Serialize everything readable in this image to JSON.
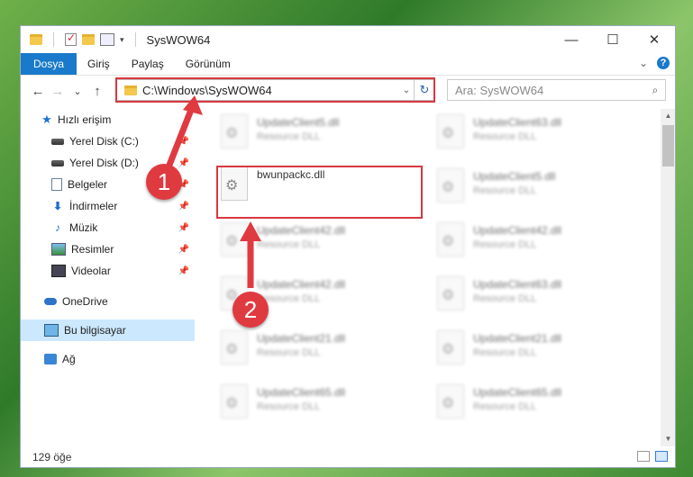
{
  "window": {
    "title": "SysWOW64",
    "minimize": "—",
    "maximize": "☐",
    "close": "✕"
  },
  "ribbon": {
    "tabs": [
      "Dosya",
      "Giriş",
      "Paylaş",
      "Görünüm"
    ],
    "expand": "⌄",
    "help": "?"
  },
  "nav": {
    "back": "←",
    "forward": "→",
    "recent": "⌄",
    "up": "↑"
  },
  "address": {
    "path": "C:\\Windows\\SysWOW64",
    "dropdown": "⌄",
    "refresh": "↻"
  },
  "search": {
    "placeholder": "Ara: SysWOW64",
    "icon": "⌕"
  },
  "sidebar": {
    "quick_access": "Hızlı erişim",
    "items": [
      {
        "label": "Yerel Disk (C:)"
      },
      {
        "label": "Yerel Disk (D:)"
      },
      {
        "label": "Belgeler"
      },
      {
        "label": "İndirmeler"
      },
      {
        "label": "Müzik"
      },
      {
        "label": "Resimler"
      },
      {
        "label": "Videolar"
      }
    ],
    "onedrive": "OneDrive",
    "this_pc": "Bu bilgisayar",
    "network": "Ağ"
  },
  "files": {
    "left": [
      {
        "name": "UpdateClient5.dll",
        "type": "Resource DLL"
      },
      {
        "name": "bwunpackc.dll",
        "type": ""
      },
      {
        "name": "UpdateClient42.dll",
        "type": "Resource DLL"
      },
      {
        "name": "UpdateClient42.dll",
        "type": "Resource DLL"
      },
      {
        "name": "UpdateClient21.dll",
        "type": "Resource DLL"
      },
      {
        "name": "UpdateClient65.dll",
        "type": "Resource DLL"
      }
    ],
    "right": [
      {
        "name": "UpdateClient63.dll",
        "type": "Resource DLL"
      },
      {
        "name": "UpdateClient5.dll",
        "type": "Resource DLL"
      },
      {
        "name": "UpdateClient42.dll",
        "type": "Resource DLL"
      },
      {
        "name": "UpdateClient63.dll",
        "type": "Resource DLL"
      },
      {
        "name": "UpdateClient21.dll",
        "type": "Resource DLL"
      },
      {
        "name": "UpdateClient65.dll",
        "type": "Resource DLL"
      }
    ]
  },
  "status": {
    "count": "129 öğe"
  },
  "annotations": {
    "step1": "1",
    "step2": "2",
    "color": "#e03a41"
  },
  "colors": {
    "accent": "#1979ca",
    "selection": "#cce8ff",
    "highlight": "#d9373f"
  }
}
